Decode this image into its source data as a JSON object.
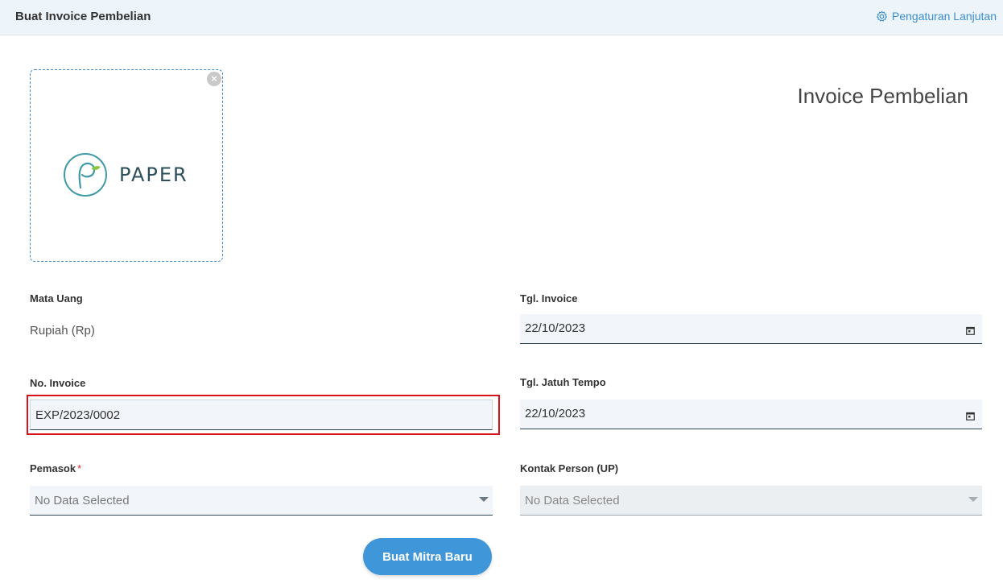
{
  "header": {
    "title": "Buat Invoice Pembelian",
    "advanced_label": "Pengaturan Lanjutan",
    "advanced_icon": "gear-icon"
  },
  "logo": {
    "text": "PAPER",
    "remove_icon": "close-icon"
  },
  "document_title": "Invoice Pembelian",
  "form": {
    "currency": {
      "label": "Mata Uang",
      "value": "Rupiah (Rp)"
    },
    "invoice_date": {
      "label": "Tgl. Invoice",
      "value": "22/10/2023",
      "icon": "calendar-icon"
    },
    "invoice_no": {
      "label": "No. Invoice",
      "value": "EXP/2023/0002"
    },
    "due_date": {
      "label": "Tgl. Jatuh Tempo",
      "value": "22/10/2023",
      "icon": "calendar-icon"
    },
    "supplier": {
      "label": "Pemasok",
      "required_mark": "*",
      "placeholder": "No Data Selected"
    },
    "contact_person": {
      "label": "Kontak Person (UP)",
      "placeholder": "No Data Selected"
    }
  },
  "buttons": {
    "new_partner": "Buat Mitra Baru"
  },
  "colors": {
    "accent": "#3f96d8",
    "link": "#3a8ed0",
    "highlight": "#d9121a",
    "header_bg": "#edf4fa"
  }
}
